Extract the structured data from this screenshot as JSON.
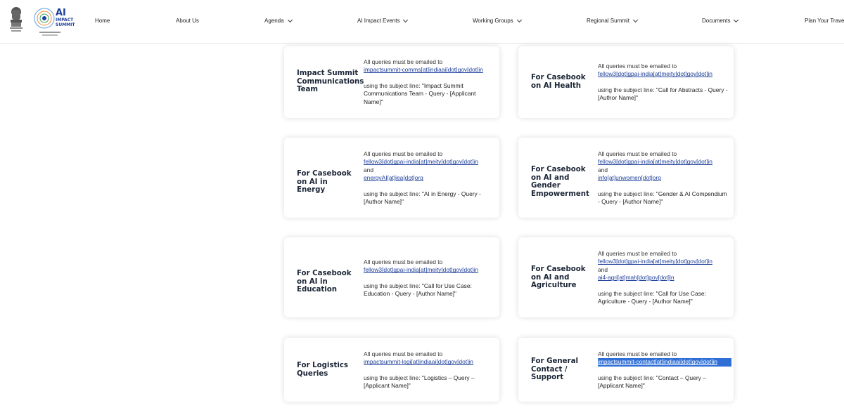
{
  "header": {
    "emblem_icon": "india-emblem-icon",
    "logo_icon": "ai-impact-summit-logo-icon",
    "logo_text": "AI IMPACT SUMMIT",
    "nav": [
      {
        "label": "Home",
        "has_dropdown": false
      },
      {
        "label": "About Us",
        "has_dropdown": false
      },
      {
        "label": "Agenda",
        "has_dropdown": true
      },
      {
        "label": "AI Impact Events",
        "has_dropdown": true
      },
      {
        "label": "Working Groups",
        "has_dropdown": true
      },
      {
        "label": "Regional Summit",
        "has_dropdown": true
      },
      {
        "label": "Documents",
        "has_dropdown": true
      },
      {
        "label": "Plan Your Travel",
        "has_dropdown": false
      }
    ]
  },
  "cards": [
    {
      "title": "Impact Summit Communications Team",
      "intro": "All queries must be emailed to",
      "emails": [
        "impactsummit-comms[at]indiaai[dot]gov[dot]in"
      ],
      "subject_prefix": "using the subject line: ",
      "subject": "\"Impact Summit Communications Team - Query - [Applicant Name]\""
    },
    {
      "title": "For Casebook on AI Health",
      "intro": "All queries must be emailed to",
      "emails": [
        "fellow3[dot]gpai-india[at]meity[dot]gov[dot]in"
      ],
      "subject_prefix": "using the subject line: ",
      "subject": "\"Call for Abstracts - Query - [Author Name]\""
    },
    {
      "title": "For Casebook on AI in Energy",
      "intro": "All queries must be emailed to",
      "emails": [
        "fellow3[dot]gpai-india[at]meity[dot]gov[dot]in",
        "energyAI[at]iea[dot]org"
      ],
      "and_label": "and",
      "subject_prefix": "using the subject line: ",
      "subject": "\"AI in Energy - Query - [Author Name]\""
    },
    {
      "title": "For Casebook on AI and Gender Empowerment",
      "intro": "All queries must be emailed to",
      "emails": [
        "fellow3[dot]gpai-india[at]meity[dot]gov[dot]in",
        "info[at]unwomen[dot]org"
      ],
      "and_label": "and",
      "subject_prefix": "using the subject line: ",
      "subject": "\"Gender & AI Compendium - Query - [Author Name]\""
    },
    {
      "title": "For Casebook on AI in Education",
      "intro": "All queries must be emailed to",
      "emails": [
        "fellow3[dot]gpai-india[at]meity[dot]gov[dot]in"
      ],
      "subject_prefix": "using the subject line: ",
      "subject": "\"Call for Use Case: Education - Query - [Author Name]\""
    },
    {
      "title": "For Casebook on AI and Agriculture",
      "intro": "All queries must be emailed to",
      "emails": [
        "fellow3[dot]gpai-india[at]meity[dot]gov[dot]in",
        "ai4-agri[at]mah[dot]gov[dot]in"
      ],
      "and_label": "and",
      "subject_prefix": "using the subject line: ",
      "subject": "\"Call for Use Case: Agriculture - Query - [Author Name]\""
    },
    {
      "title": "For Logistics Queries",
      "intro": "All queries must be emailed to",
      "emails": [
        "impactsummit-logi[at]indiaai[dot]gov[dot]in"
      ],
      "subject_prefix": "using the subject line: ",
      "subject": "\"Logistics – Query – [Applicant Name]\""
    },
    {
      "title": "For General Contact / Support",
      "intro": "All queries must be emailed to",
      "emails": [
        "impactsummit-contact[at]indiaai[dot]gov[dot]in"
      ],
      "subject_prefix": "using the subject line: ",
      "subject": "\"Contact – Query – [Applicant Name]\""
    }
  ]
}
